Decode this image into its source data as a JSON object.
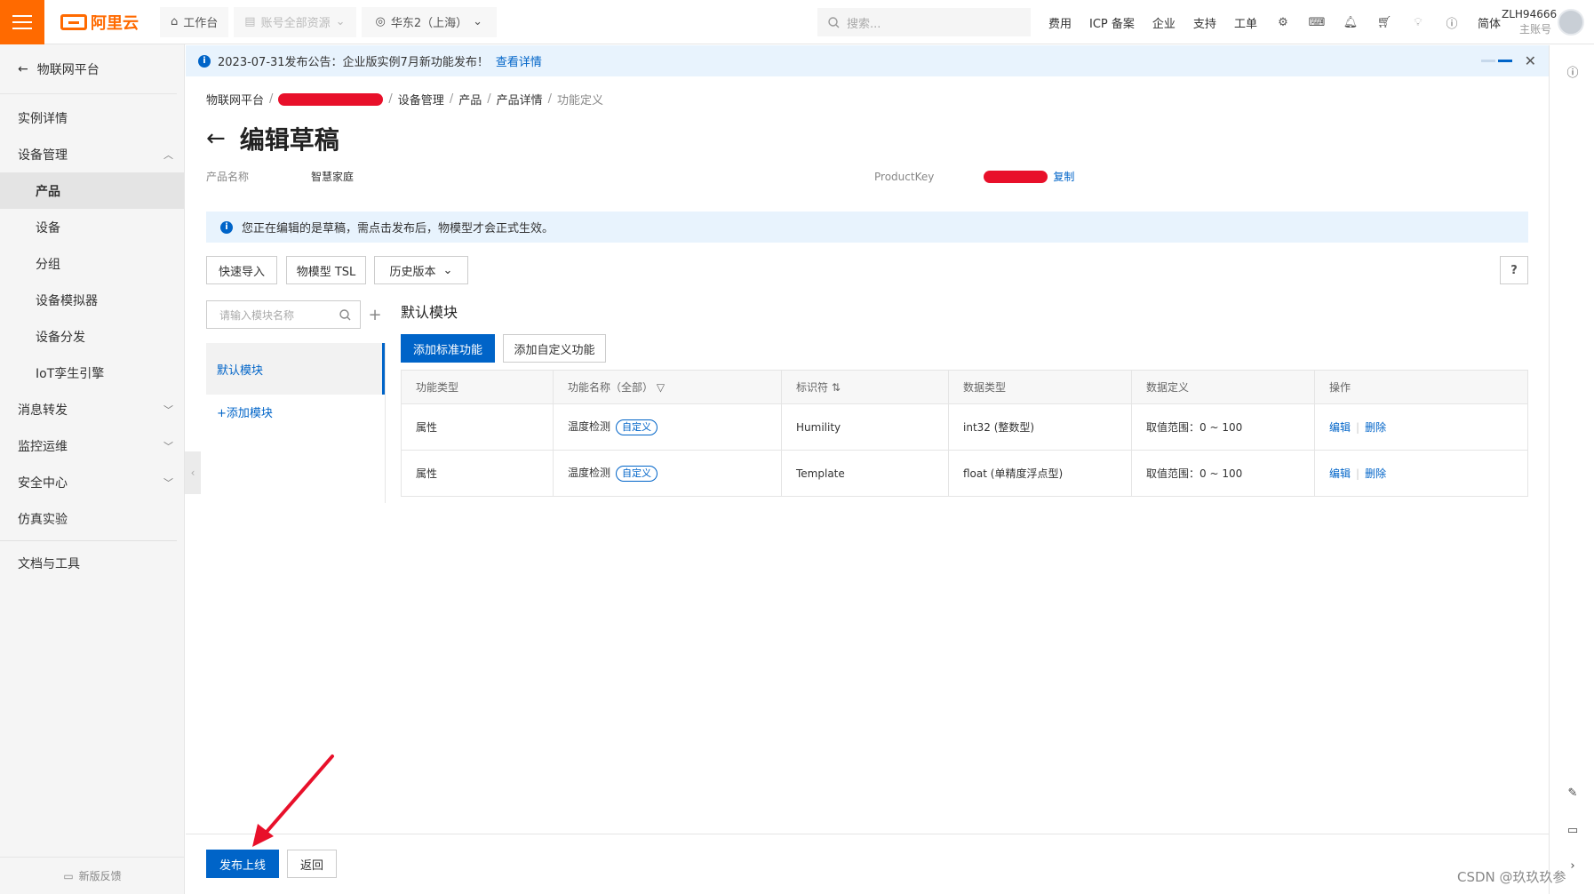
{
  "topbar": {
    "workbench": "工作台",
    "resources": "账号全部资源",
    "region": "华东2（上海）",
    "search_placeholder": "搜索...",
    "links": [
      "费用",
      "ICP 备案",
      "企业",
      "支持",
      "工单"
    ],
    "lang": "简体",
    "user_name": "ZLH94666",
    "user_role": "主账号",
    "brand_color": "#ff6a00"
  },
  "sidebar": {
    "title": "物联网平台",
    "items": [
      {
        "label": "实例详情"
      },
      {
        "label": "设备管理"
      },
      {
        "label": "产品"
      },
      {
        "label": "设备"
      },
      {
        "label": "分组"
      },
      {
        "label": "设备模拟器"
      },
      {
        "label": "设备分发"
      },
      {
        "label": "IoT孪生引擎"
      },
      {
        "label": "消息转发"
      },
      {
        "label": "监控运维"
      },
      {
        "label": "安全中心"
      },
      {
        "label": "仿真实验"
      },
      {
        "label": "文档与工具"
      }
    ],
    "feedback": "新版反馈"
  },
  "notice": {
    "text": "2023-07-31发布公告：企业版实例7月新功能发布！",
    "link": "查看详情"
  },
  "breadcrumb": {
    "items": [
      "物联网平台",
      "设备管理",
      "产品",
      "产品详情"
    ],
    "current": "功能定义"
  },
  "page": {
    "title": "编辑草稿",
    "product_name_label": "产品名称",
    "product_name": "智慧家庭",
    "product_key_label": "ProductKey",
    "copy": "复制",
    "draft_tip": "您正在编辑的是草稿，需点击发布后，物模型才会正式生效。"
  },
  "toolbar": {
    "quick_import": "快速导入",
    "tsl": "物模型 TSL",
    "history": "历史版本"
  },
  "modules": {
    "search_placeholder": "请输入模块名称",
    "active": "默认模块",
    "add": "+添加模块"
  },
  "section": {
    "title": "默认模块",
    "add_standard": "添加标准功能",
    "add_custom": "添加自定义功能"
  },
  "table": {
    "headers": [
      "功能类型",
      "功能名称（全部）",
      "标识符",
      "数据类型",
      "数据定义",
      "操作"
    ],
    "rows": [
      {
        "type": "属性",
        "name": "温度检测",
        "tag": "自定义",
        "identifier": "Humility",
        "datatype": "int32 (整数型)",
        "definition": "取值范围：0 ~ 100",
        "edit": "编辑",
        "delete": "删除"
      },
      {
        "type": "属性",
        "name": "温度检测",
        "tag": "自定义",
        "identifier": "Template",
        "datatype": "float (单精度浮点型)",
        "definition": "取值范围：0 ~ 100",
        "edit": "编辑",
        "delete": "删除"
      }
    ]
  },
  "footer": {
    "publish": "发布上线",
    "back": "返回"
  },
  "watermark": "CSDN @玖玖玖参"
}
